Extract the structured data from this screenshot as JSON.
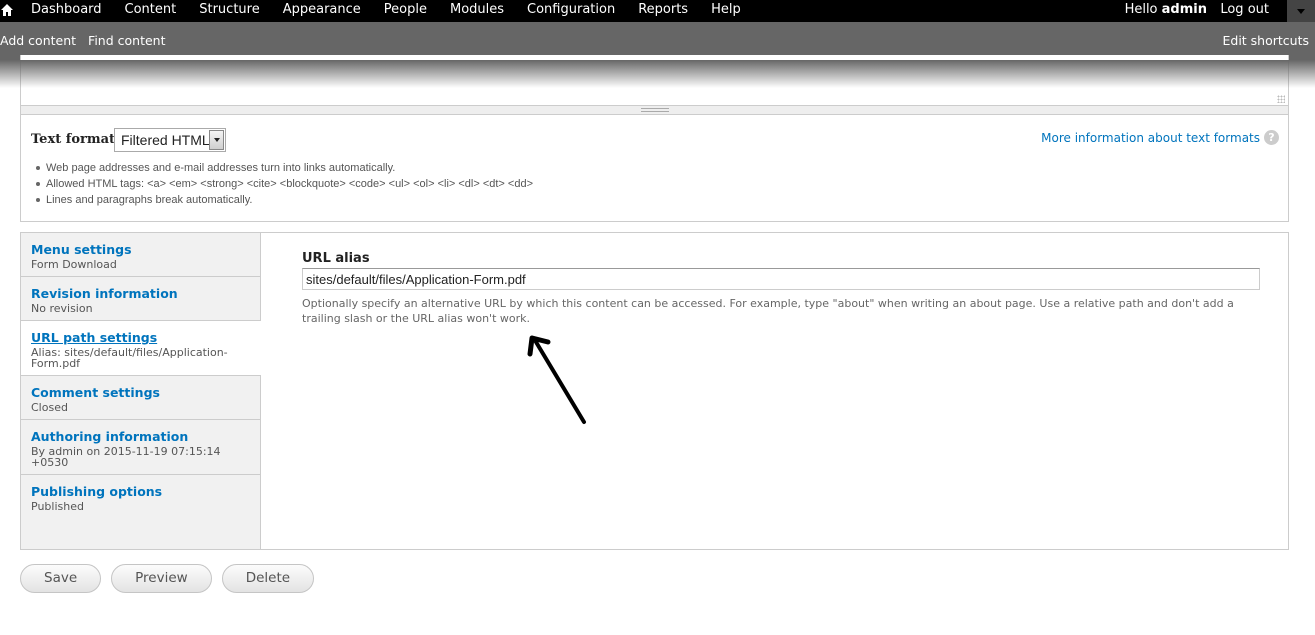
{
  "toolbar": {
    "menu": [
      "Dashboard",
      "Content",
      "Structure",
      "Appearance",
      "People",
      "Modules",
      "Configuration",
      "Reports",
      "Help"
    ],
    "greeting": "Hello ",
    "username": "admin",
    "logout": "Log out"
  },
  "shortcuts": {
    "items": [
      "Add content",
      "Find content"
    ],
    "edit": "Edit shortcuts"
  },
  "text_format": {
    "label": "Text format",
    "selected": "Filtered HTML",
    "more_info": "More information about text formats",
    "help_glyph": "?",
    "tips": [
      "Web page addresses and e-mail addresses turn into links automatically.",
      "Allowed HTML tags: <a> <em> <strong> <cite> <blockquote> <code> <ul> <ol> <li> <dl> <dt> <dd>",
      "Lines and paragraphs break automatically."
    ]
  },
  "vertical_tabs": [
    {
      "title": "Menu settings",
      "summary": "Form Download"
    },
    {
      "title": "Revision information",
      "summary": "No revision"
    },
    {
      "title": "URL path settings",
      "summary": "Alias: sites/default/files/Application-Form.pdf",
      "selected": true
    },
    {
      "title": "Comment settings",
      "summary": "Closed"
    },
    {
      "title": "Authoring information",
      "summary": "By admin on 2015-11-19 07:15:14 +0530"
    },
    {
      "title": "Publishing options",
      "summary": "Published"
    }
  ],
  "url_alias": {
    "label": "URL alias",
    "value": "sites/default/files/Application-Form.pdf",
    "description": "Optionally specify an alternative URL by which this content can be accessed. For example, type \"about\" when writing an about page. Use a relative path and don't add a trailing slash or the URL alias won't work."
  },
  "actions": {
    "save": "Save",
    "preview": "Preview",
    "delete": "Delete"
  },
  "colors": {
    "link": "#0074bd",
    "toolbar": "#000000",
    "shortcuts": "#666666"
  }
}
